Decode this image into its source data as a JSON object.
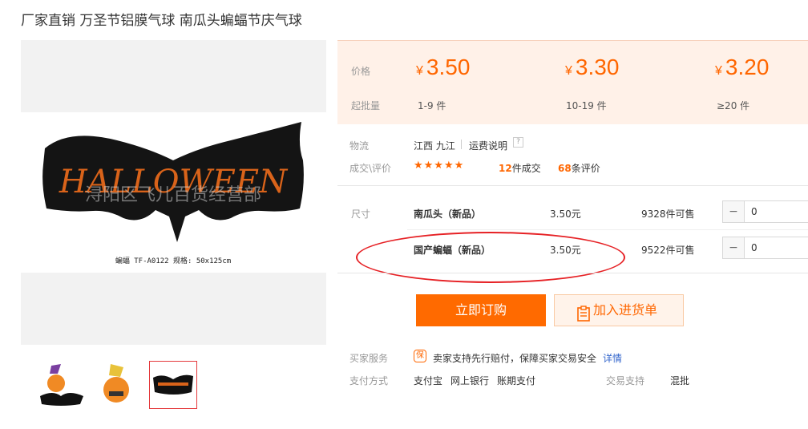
{
  "product": {
    "title": "厂家直销 万圣节铝膜气球 南瓜头蝙蝠节庆气球",
    "image_caption": "蝙蝠 TF-A0122 规格: 50x125cm",
    "watermark": "浔阳区飞儿百货经营部",
    "balloon_text": "HALLOWEEN"
  },
  "pricing": {
    "price_label": "价格",
    "moq_label": "起批量",
    "tiers": [
      {
        "currency": "¥",
        "price": "3.50",
        "qty": "1-9 件"
      },
      {
        "currency": "¥",
        "price": "3.30",
        "qty": "10-19 件"
      },
      {
        "currency": "¥",
        "price": "3.20",
        "qty": "≥20 件"
      }
    ]
  },
  "logistics": {
    "label": "物流",
    "origin": "江西 九江",
    "shipping_link": "运费说明",
    "help_icon": "?"
  },
  "stats": {
    "label": "成交\\评价",
    "stars": "★★★★★",
    "deals_count": "12",
    "deals_unit": "件成交",
    "reviews_count": "68",
    "reviews_unit": "条评价"
  },
  "sizes": {
    "label": "尺寸",
    "rows": [
      {
        "name": "南瓜头（新品）",
        "price": "3.50元",
        "stock": "9328件可售",
        "qty": "0"
      },
      {
        "name": "国产蝙蝠（新品）",
        "price": "3.50元",
        "stock": "9522件可售",
        "qty": "0"
      }
    ]
  },
  "actions": {
    "buy_now": "立即订购",
    "add_to_list": "加入进货单"
  },
  "service": {
    "label": "买家服务",
    "badge": "保",
    "text": "卖家支持先行赔付，保障买家交易安全",
    "details_link": "详情"
  },
  "payment": {
    "label": "支付方式",
    "methods": [
      "支付宝",
      "网上银行",
      "账期支付"
    ],
    "trade_label": "交易支持",
    "trade_value": "混批"
  },
  "colors": {
    "accent": "#ff6a00",
    "price_bg": "#fff1e8",
    "annotation": "#e62125"
  }
}
